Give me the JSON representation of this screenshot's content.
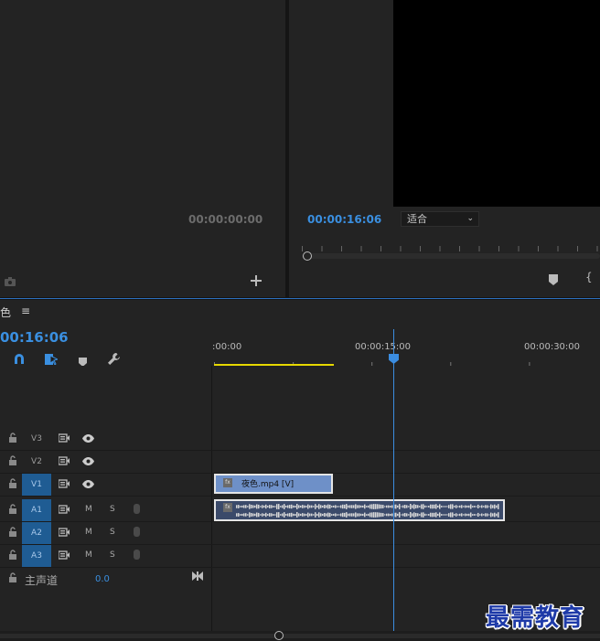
{
  "source": {
    "timecode": "00:00:00:00"
  },
  "program": {
    "timecode": "00:00:16:06",
    "fit_label": "适合"
  },
  "timeline": {
    "panel_title": "色",
    "menu_glyph": "≡",
    "timecode": "00:16:06",
    "ruler_labels": [
      ":00:00",
      "00:00:15:00",
      "00:00:30:00"
    ],
    "tracks": [
      {
        "name": "V3",
        "kind": "video",
        "active": false
      },
      {
        "name": "V2",
        "kind": "video",
        "active": false
      },
      {
        "name": "V1",
        "kind": "video",
        "active": true
      },
      {
        "name": "A1",
        "kind": "audio",
        "active": true
      },
      {
        "name": "A2",
        "kind": "audio",
        "active": true
      },
      {
        "name": "A3",
        "kind": "audio",
        "active": true
      }
    ],
    "master": {
      "label": "主声道",
      "value": "0.0"
    },
    "mute_label": "M",
    "solo_label": "S",
    "video_clip_label": "夜色.mp4 [V]",
    "fx_label": "fx"
  },
  "watermark": "最需教育",
  "colors": {
    "accent": "#3a8fe0",
    "track_active": "#1f5c93",
    "work_bar": "#e6d800",
    "video_clip": "#6e90c8",
    "audio_clip": "#3b4a6a"
  },
  "icons": [
    "camera-icon",
    "add-icon",
    "marker-icon",
    "snap-icon",
    "linked-selection-icon",
    "wrench-icon",
    "lock-icon",
    "toggle-output-icon",
    "eye-icon",
    "mic-icon"
  ]
}
